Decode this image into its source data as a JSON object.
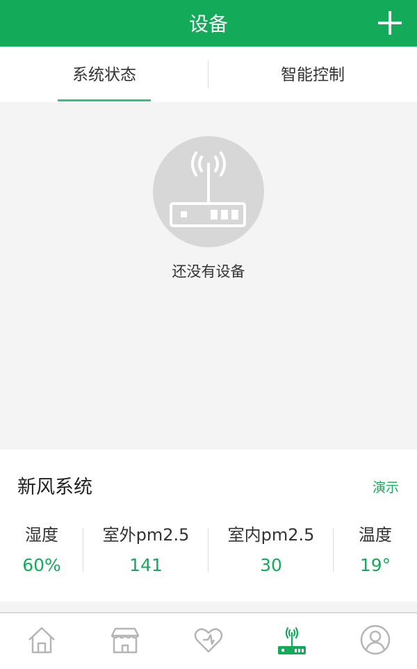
{
  "header": {
    "title": "设备",
    "add_icon": "plus-icon"
  },
  "tabs": [
    {
      "label": "系统状态",
      "active": true
    },
    {
      "label": "智能控制",
      "active": false
    }
  ],
  "empty_state": {
    "icon": "router-icon",
    "message": "还没有设备"
  },
  "fresh_air": {
    "title": "新风系统",
    "demo_label": "演示",
    "stats": [
      {
        "label": "湿度",
        "value": "60%"
      },
      {
        "label": "室外pm2.5",
        "value": "141"
      },
      {
        "label": "室内pm2.5",
        "value": "30"
      },
      {
        "label": "温度",
        "value": "19°"
      }
    ]
  },
  "bottom_nav": [
    {
      "icon": "home-icon",
      "active": false
    },
    {
      "icon": "store-icon",
      "active": false
    },
    {
      "icon": "heart-icon",
      "active": false
    },
    {
      "icon": "router-icon",
      "active": true
    },
    {
      "icon": "user-icon",
      "active": false
    }
  ],
  "colors": {
    "primary": "#13ab5a",
    "indicator": "#2fc47a",
    "inactive_icon": "#b5b5b5"
  }
}
